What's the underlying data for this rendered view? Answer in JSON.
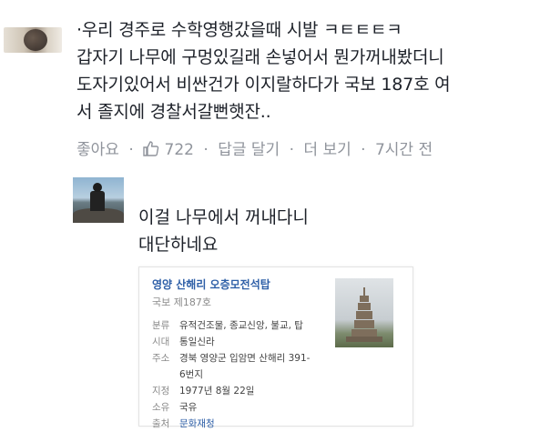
{
  "post": {
    "comment1": {
      "lines": [
        "·우리 경주로 수학영행갔을때 시발 ㅋㅌㅌㅌㅋ",
        "갑자기 나무에 구멍있길래 손넣어서 뭔가꺼내봤더니",
        "도자기있어서 비싼건가 이지랄하다가 국보 187호 여",
        "서 졸지에 경찰서갈뻔햇잔.."
      ],
      "like_label": "좋아요",
      "like_count": "722",
      "reply_label": "답글 달기",
      "more_label": "더 보기",
      "time": "7시간 전",
      "dot": "·"
    },
    "comment2": {
      "lines": [
        "이걸 나무에서 꺼내다니",
        "대단하네요"
      ]
    },
    "card": {
      "title": "영양 산해리 오층모전석탑",
      "subtitle": "국보 제187호",
      "rows": [
        {
          "key": "분류",
          "value": "유적건조물, 종교신앙, 불교, 탑"
        },
        {
          "key": "시대",
          "value": "통일신라"
        },
        {
          "key": "주소",
          "value": "경북 영양군 입암면 산해리 391-"
        },
        {
          "key": "",
          "value": "6번지"
        },
        {
          "key": "지정",
          "value": "1977년 8월 22일"
        },
        {
          "key": "소유",
          "value": "국유"
        },
        {
          "key": "출처",
          "value": "문화재청"
        }
      ]
    }
  },
  "colors": {
    "text": "#1d2129",
    "meta": "#90949c",
    "link": "#2e5fa7"
  },
  "icons": {
    "like": "thumbs-up-icon"
  }
}
